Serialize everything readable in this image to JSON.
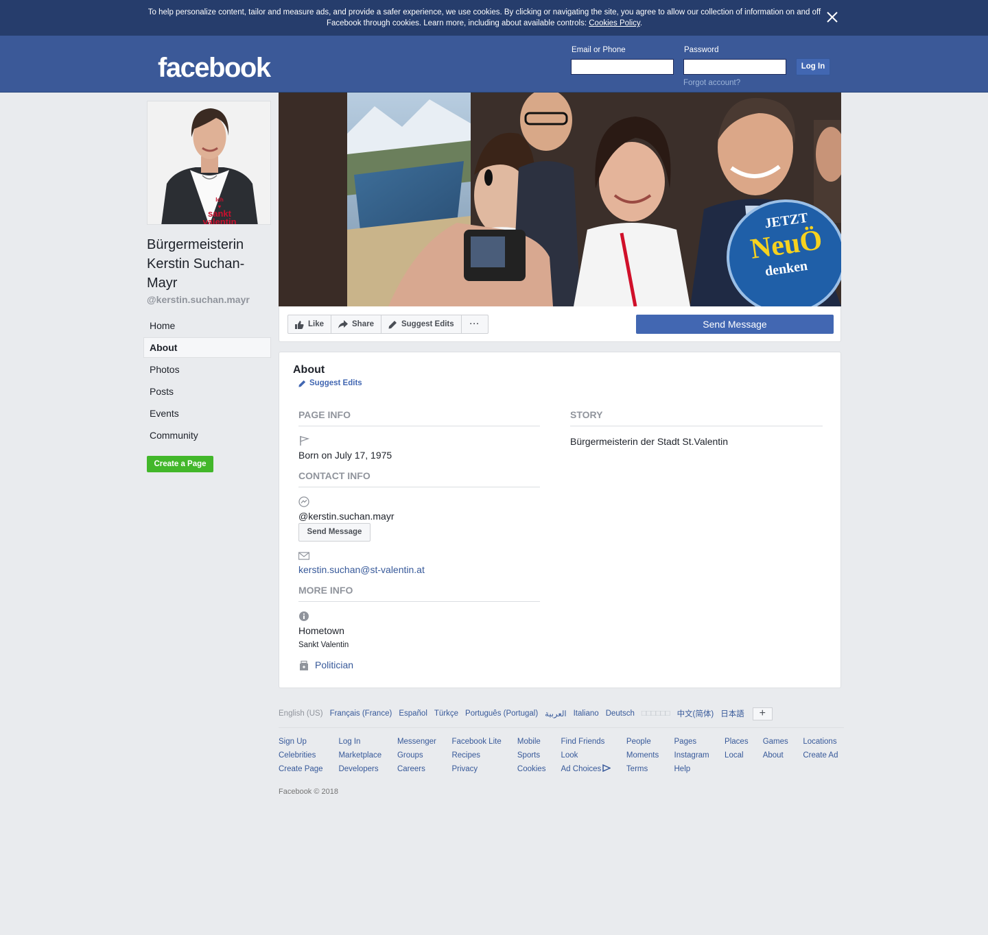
{
  "cookie_banner": {
    "text": "To help personalize content, tailor and measure ads, and provide a safer experience, we use cookies. By clicking or navigating the site, you agree to allow our collection of information on and off Facebook through cookies. Learn more, including about available controls: ",
    "policy_link": "Cookies Policy",
    "policy_suffix": "."
  },
  "header": {
    "logo": "facebook",
    "email_label": "Email or Phone",
    "password_label": "Password",
    "login_button": "Log In",
    "forgot_link": "Forgot account?"
  },
  "profile": {
    "name": "Bürgermeisterin Kerstin Suchan-Mayr",
    "handle": "@kerstin.suchan.mayr",
    "avatar_shirt_text": [
      "Ich",
      "sankt",
      "valentin"
    ]
  },
  "nav": {
    "items": [
      "Home",
      "About",
      "Photos",
      "Posts",
      "Events",
      "Community"
    ],
    "active": "About",
    "create_page": "Create a Page"
  },
  "cover": {
    "badge_top": "JETZT",
    "badge_mid": "NeuÖ",
    "badge_bottom": "denken"
  },
  "actions": {
    "like": "Like",
    "share": "Share",
    "suggest_edits": "Suggest Edits",
    "more": "···",
    "send_message": "Send Message"
  },
  "about": {
    "title": "About",
    "suggest_edits": "Suggest Edits",
    "page_info_header": "PAGE INFO",
    "born": "Born on July 17, 1975",
    "contact_info_header": "CONTACT INFO",
    "messenger_handle": "@kerstin.suchan.mayr",
    "send_message_button": "Send Message",
    "email": "kerstin.suchan@st-valentin.at",
    "more_info_header": "MORE INFO",
    "hometown_label": "Hometown",
    "hometown_value": "Sankt Valentin",
    "category": "Politician",
    "story_header": "STORY",
    "story_text": "Bürgermeisterin der Stadt St.Valentin"
  },
  "footer": {
    "languages": [
      "English (US)",
      "Français (France)",
      "Español",
      "Türkçe",
      "Português (Portugal)",
      "العربية",
      "Italiano",
      "Deutsch",
      "□□□□□□",
      "中文(简体)",
      "日本語"
    ],
    "current_language": "English (US)",
    "more_languages": "+",
    "columns": [
      [
        "Sign Up",
        "Celebrities",
        "Create Page"
      ],
      [
        "Log In",
        "Marketplace",
        "Developers"
      ],
      [
        "Messenger",
        "Groups",
        "Careers"
      ],
      [
        "Facebook Lite",
        "Recipes",
        "Privacy"
      ],
      [
        "Mobile",
        "Sports",
        "Cookies"
      ],
      [
        "Find Friends",
        "Look",
        "Ad Choices"
      ],
      [
        "People",
        "Moments",
        "Terms"
      ],
      [
        "Pages",
        "Instagram",
        "Help"
      ],
      [
        "Places",
        "Local"
      ],
      [
        "Games",
        "About"
      ],
      [
        "Locations",
        "Create Ad"
      ]
    ],
    "copyright": "Facebook © 2018"
  },
  "colors": {
    "brand": "#3b5998",
    "cookie_bg": "#263d6c",
    "button_blue": "#4267b2",
    "create_green": "#42b72a",
    "page_bg": "#e9ebee"
  }
}
